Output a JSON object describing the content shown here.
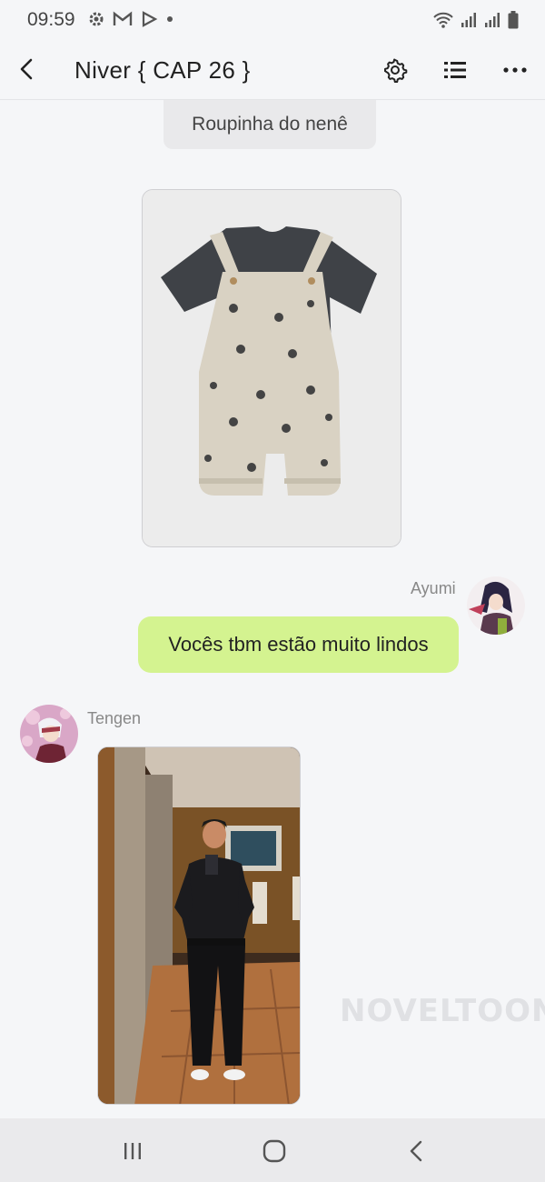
{
  "status_bar": {
    "time": "09:59",
    "left_icons": [
      "gear-icon",
      "gmail-icon",
      "play-icon",
      "dot-icon"
    ],
    "right_icons": [
      "wifi-icon",
      "signal-icon",
      "signal-icon",
      "battery-icon"
    ]
  },
  "header": {
    "title": "Niver { CAP 26 }",
    "actions": [
      "settings-icon",
      "list-icon",
      "more-icon"
    ]
  },
  "messages": [
    {
      "type": "caption",
      "text": "Roupinha do nenê"
    },
    {
      "type": "image",
      "subject": "baby overalls with mouse print and dark t-shirt"
    },
    {
      "type": "text",
      "sender": "Ayumi",
      "text": "Vocês tbm estão muito lindos",
      "side": "right"
    },
    {
      "type": "image",
      "sender": "Tengen",
      "subject": "mirror selfie in hallway",
      "side": "left"
    }
  ],
  "watermark": "NOVELTOON",
  "colors": {
    "outgoing_bubble": "#d4f390",
    "caption_bubble": "#e9e9eb",
    "background": "#f5f6f8"
  }
}
